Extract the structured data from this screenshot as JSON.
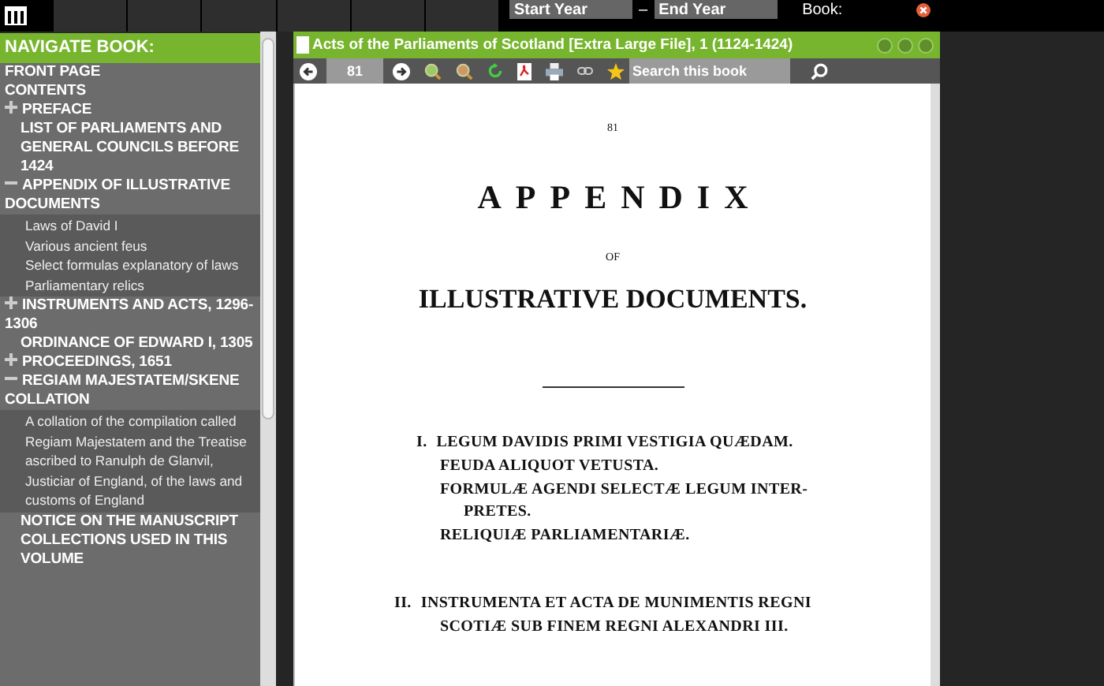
{
  "top_bar": {
    "start_year": {
      "placeholder": "Start Year"
    },
    "separator": "–",
    "end_year": {
      "placeholder": "End Year"
    },
    "book_label": "Book:"
  },
  "sidebar": {
    "title": "NAVIGATE BOOK:",
    "items": [
      {
        "label": "FRONT PAGE",
        "kind": "top"
      },
      {
        "label": "CONTENTS",
        "kind": "top"
      },
      {
        "label": "PREFACE",
        "kind": "section",
        "expanded": false
      },
      {
        "label": "LIST OF PARLIAMENTS AND GENERAL COUNCILS BEFORE 1424",
        "kind": "leaf"
      },
      {
        "label": "APPENDIX OF ILLUSTRATIVE DOCUMENTS",
        "kind": "section",
        "expanded": true,
        "children": [
          {
            "label": "Laws of David I"
          },
          {
            "label": "Various ancient feus"
          },
          {
            "label": "Select formulas explanatory of laws"
          },
          {
            "label": "Parliamentary relics"
          }
        ]
      },
      {
        "label": "INSTRUMENTS AND ACTS, 1296-1306",
        "kind": "section",
        "expanded": false
      },
      {
        "label": "ORDINANCE OF EDWARD I, 1305",
        "kind": "leaf"
      },
      {
        "label": "PROCEEDINGS, 1651",
        "kind": "section",
        "expanded": false
      },
      {
        "label": "REGIAM MAJESTATEM/SKENE COLLATION",
        "kind": "section",
        "expanded": true,
        "children": [
          {
            "label": "A collation of the compilation called Regiam Majestatem and the Treatise ascribed to Ranulph de Glanvil, Justiciar of England, of the laws and customs of England"
          }
        ]
      },
      {
        "label": "NOTICE ON THE MANUSCRIPT COLLECTIONS USED IN THIS VOLUME",
        "kind": "leaf"
      }
    ]
  },
  "viewer": {
    "title": "Acts of the Parliaments of Scotland [Extra Large File], 1 (1124-1424)",
    "page_field": "81",
    "search": {
      "placeholder": "Search this book"
    }
  },
  "page": {
    "number": "81",
    "heading": "APPENDIX",
    "of": "OF",
    "subheading": "ILLUSTRATIVE DOCUMENTS.",
    "lines": [
      {
        "kind": "numbered",
        "num": "I.",
        "text": "LEGUM DAVIDIS PRIMI VESTIGIA QUÆDAM."
      },
      {
        "kind": "sub",
        "text": "FEUDA ALIQUOT VETUSTA."
      },
      {
        "kind": "sub",
        "text": "FORMULÆ AGENDI SELECTÆ LEGUM INTER-"
      },
      {
        "kind": "cont",
        "text": "PRETES."
      },
      {
        "kind": "sub",
        "text": "RELIQUIÆ PARLIAMENTARIÆ."
      },
      {
        "kind": "numbered",
        "num": "II.",
        "text": "INSTRUMENTA ET ACTA DE MUNIMENTIS REGNI"
      },
      {
        "kind": "sub",
        "text": "SCOTIÆ SUB FINEM REGNI ALEXANDRI III."
      }
    ]
  }
}
